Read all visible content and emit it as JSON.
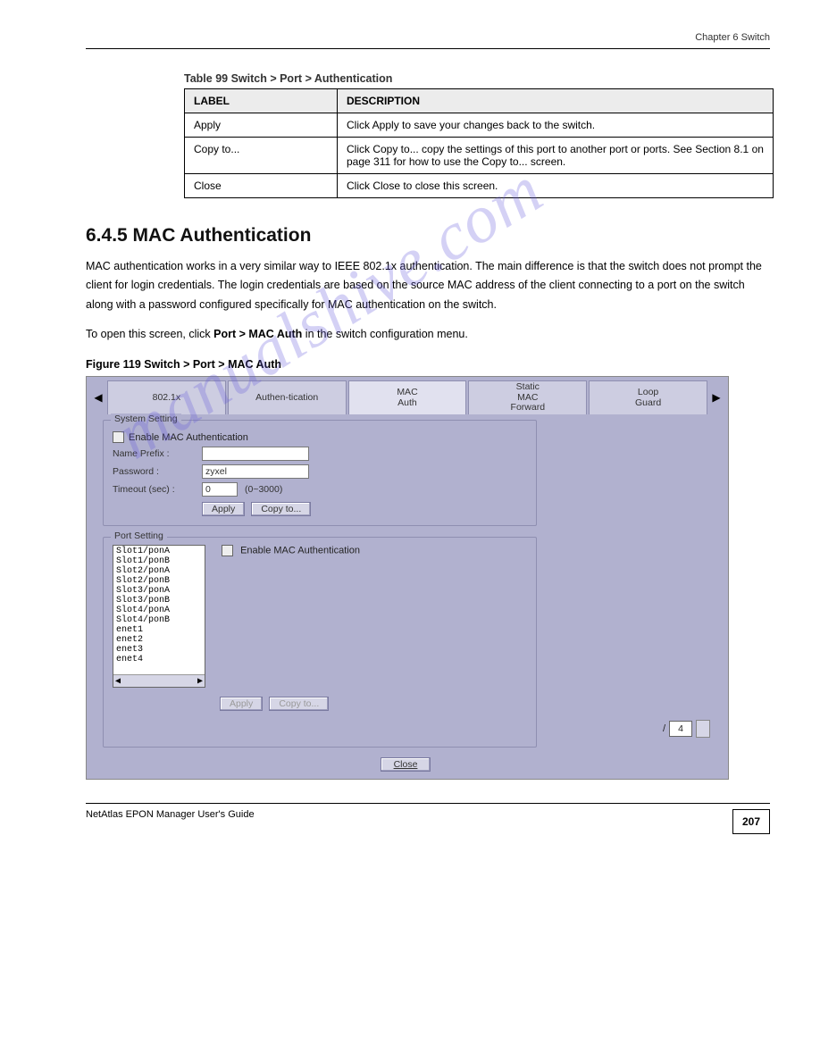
{
  "chapter_header": "Chapter 6 Switch",
  "table_caption": "Table 99   Switch > Port > Authentication",
  "table_header_label": "LABEL",
  "table_header_desc": "DESCRIPTION",
  "row_apply_label": "Apply",
  "row_apply_desc": "Click Apply to save your changes back to the switch.",
  "row_copyto_label": "Copy to...",
  "row_copyto_desc": "Click Copy to... copy the settings of this port to another port or ports. See Section 8.1 on page 311 for how to use the Copy to... screen.",
  "row_close_label": "Close",
  "row_close_desc": "Click Close to close this screen.",
  "section_heading": "6.4.5  MAC Authentication",
  "para1": "MAC authentication works in a very similar way to IEEE 802.1x authentication. The main difference is that the switch does not prompt the client for login credentials. The login credentials are based on the source MAC address of the client connecting to a port on the switch along with a password configured specifically for MAC authentication on the switch.",
  "para2_before": "To open this screen, click ",
  "para2_bold": "Port > MAC Auth",
  "para2_after": " in the switch configuration menu.",
  "figure_caption": "Figure 119   Switch > Port > MAC Auth",
  "ui": {
    "tabs": [
      "802.1x",
      "Authen-tication",
      "MAC\nAuth",
      "Static\nMAC\nForward",
      "Loop\nGuard"
    ],
    "active_tab_index": 2,
    "system_setting_legend": "System Setting",
    "enable_mac_auth": "Enable MAC Authentication",
    "name_prefix_label": "Name Prefix :",
    "name_prefix_value": "",
    "password_label": "Password :",
    "password_value": "zyxel",
    "timeout_label": "Timeout (sec) :",
    "timeout_value": "0",
    "timeout_hint": "(0~3000)",
    "apply_btn": "Apply",
    "copyto_btn": "Copy to...",
    "port_setting_legend": "Port Setting",
    "port_enable_mac_auth": "Enable MAC Authentication",
    "port_list": [
      "Slot1/ponA",
      "Slot1/ponB",
      "Slot2/ponA",
      "Slot2/ponB",
      "Slot3/ponA",
      "Slot3/ponB",
      "Slot4/ponA",
      "Slot4/ponB",
      "enet1",
      "enet2",
      "enet3",
      "enet4"
    ],
    "page_total": "4",
    "close_btn": "Close"
  },
  "watermark": "manualshive.com",
  "footer_left": "NetAtlas EPON Manager User's Guide",
  "footer_page": "207"
}
